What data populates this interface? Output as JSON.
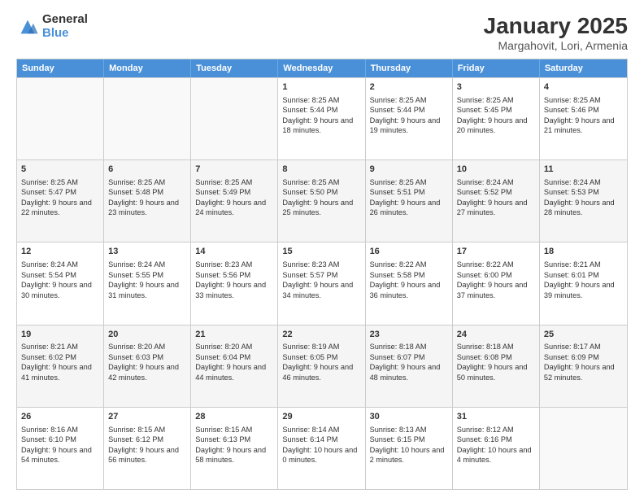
{
  "logo": {
    "general": "General",
    "blue": "Blue"
  },
  "title": "January 2025",
  "subtitle": "Margahovit, Lori, Armenia",
  "days": [
    "Sunday",
    "Monday",
    "Tuesday",
    "Wednesday",
    "Thursday",
    "Friday",
    "Saturday"
  ],
  "weeks": [
    [
      {
        "day": "",
        "empty": true
      },
      {
        "day": "",
        "empty": true
      },
      {
        "day": "",
        "empty": true
      },
      {
        "day": "1",
        "sunrise": "8:25 AM",
        "sunset": "5:44 PM",
        "daylight": "9 hours and 18 minutes."
      },
      {
        "day": "2",
        "sunrise": "8:25 AM",
        "sunset": "5:44 PM",
        "daylight": "9 hours and 19 minutes."
      },
      {
        "day": "3",
        "sunrise": "8:25 AM",
        "sunset": "5:45 PM",
        "daylight": "9 hours and 20 minutes."
      },
      {
        "day": "4",
        "sunrise": "8:25 AM",
        "sunset": "5:46 PM",
        "daylight": "9 hours and 21 minutes."
      }
    ],
    [
      {
        "day": "5",
        "sunrise": "8:25 AM",
        "sunset": "5:47 PM",
        "daylight": "9 hours and 22 minutes."
      },
      {
        "day": "6",
        "sunrise": "8:25 AM",
        "sunset": "5:48 PM",
        "daylight": "9 hours and 23 minutes."
      },
      {
        "day": "7",
        "sunrise": "8:25 AM",
        "sunset": "5:49 PM",
        "daylight": "9 hours and 24 minutes."
      },
      {
        "day": "8",
        "sunrise": "8:25 AM",
        "sunset": "5:50 PM",
        "daylight": "9 hours and 25 minutes."
      },
      {
        "day": "9",
        "sunrise": "8:25 AM",
        "sunset": "5:51 PM",
        "daylight": "9 hours and 26 minutes."
      },
      {
        "day": "10",
        "sunrise": "8:24 AM",
        "sunset": "5:52 PM",
        "daylight": "9 hours and 27 minutes."
      },
      {
        "day": "11",
        "sunrise": "8:24 AM",
        "sunset": "5:53 PM",
        "daylight": "9 hours and 28 minutes."
      }
    ],
    [
      {
        "day": "12",
        "sunrise": "8:24 AM",
        "sunset": "5:54 PM",
        "daylight": "9 hours and 30 minutes."
      },
      {
        "day": "13",
        "sunrise": "8:24 AM",
        "sunset": "5:55 PM",
        "daylight": "9 hours and 31 minutes."
      },
      {
        "day": "14",
        "sunrise": "8:23 AM",
        "sunset": "5:56 PM",
        "daylight": "9 hours and 33 minutes."
      },
      {
        "day": "15",
        "sunrise": "8:23 AM",
        "sunset": "5:57 PM",
        "daylight": "9 hours and 34 minutes."
      },
      {
        "day": "16",
        "sunrise": "8:22 AM",
        "sunset": "5:58 PM",
        "daylight": "9 hours and 36 minutes."
      },
      {
        "day": "17",
        "sunrise": "8:22 AM",
        "sunset": "6:00 PM",
        "daylight": "9 hours and 37 minutes."
      },
      {
        "day": "18",
        "sunrise": "8:21 AM",
        "sunset": "6:01 PM",
        "daylight": "9 hours and 39 minutes."
      }
    ],
    [
      {
        "day": "19",
        "sunrise": "8:21 AM",
        "sunset": "6:02 PM",
        "daylight": "9 hours and 41 minutes."
      },
      {
        "day": "20",
        "sunrise": "8:20 AM",
        "sunset": "6:03 PM",
        "daylight": "9 hours and 42 minutes."
      },
      {
        "day": "21",
        "sunrise": "8:20 AM",
        "sunset": "6:04 PM",
        "daylight": "9 hours and 44 minutes."
      },
      {
        "day": "22",
        "sunrise": "8:19 AM",
        "sunset": "6:05 PM",
        "daylight": "9 hours and 46 minutes."
      },
      {
        "day": "23",
        "sunrise": "8:18 AM",
        "sunset": "6:07 PM",
        "daylight": "9 hours and 48 minutes."
      },
      {
        "day": "24",
        "sunrise": "8:18 AM",
        "sunset": "6:08 PM",
        "daylight": "9 hours and 50 minutes."
      },
      {
        "day": "25",
        "sunrise": "8:17 AM",
        "sunset": "6:09 PM",
        "daylight": "9 hours and 52 minutes."
      }
    ],
    [
      {
        "day": "26",
        "sunrise": "8:16 AM",
        "sunset": "6:10 PM",
        "daylight": "9 hours and 54 minutes."
      },
      {
        "day": "27",
        "sunrise": "8:15 AM",
        "sunset": "6:12 PM",
        "daylight": "9 hours and 56 minutes."
      },
      {
        "day": "28",
        "sunrise": "8:15 AM",
        "sunset": "6:13 PM",
        "daylight": "9 hours and 58 minutes."
      },
      {
        "day": "29",
        "sunrise": "8:14 AM",
        "sunset": "6:14 PM",
        "daylight": "10 hours and 0 minutes."
      },
      {
        "day": "30",
        "sunrise": "8:13 AM",
        "sunset": "6:15 PM",
        "daylight": "10 hours and 2 minutes."
      },
      {
        "day": "31",
        "sunrise": "8:12 AM",
        "sunset": "6:16 PM",
        "daylight": "10 hours and 4 minutes."
      },
      {
        "day": "",
        "empty": true
      }
    ]
  ]
}
